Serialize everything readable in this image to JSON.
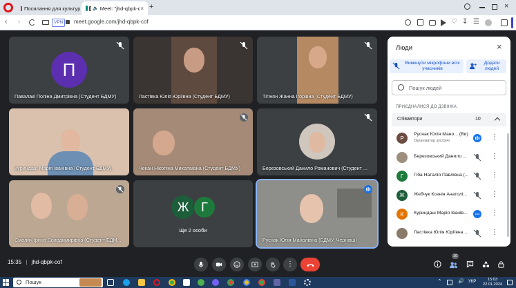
{
  "browser": {
    "tabs": [
      {
        "label": "Посилання для культур"
      },
      {
        "label": "Meet: \"jhd-qbpk-c"
      }
    ],
    "vpn_label": "VPN",
    "url": "meet.google.com/jhd-qbpk-cof"
  },
  "tiles": [
    {
      "name": "Павалакі Поліна Дмитрівна (Студент БДМУ)",
      "initial": "П",
      "avatar_color": "#5b2fb0"
    },
    {
      "name": "Ластівка Юлія Юріївна (Студент БДМУ)"
    },
    {
      "name": "Тігінян Жанна Ігорівна (Студент БДМУ)"
    },
    {
      "name": "Куриндаш Марія Іванівна (Студент БДМУ)"
    },
    {
      "name": "Чекан Ніколіна Миколаївна (Студент БДМУ)"
    },
    {
      "name": "Березовський Данило Романович (Студент ..."
    },
    {
      "name": "Смолич Ірина Володимирівна (Студент БДМ..."
    },
    {
      "name": "Ще 2 особи",
      "initials": [
        "Ж",
        "Г"
      ]
    },
    {
      "name": "Руснак Юлія Манолівна (БДМУ, Чернівці)"
    }
  ],
  "panel": {
    "title": "Люди",
    "mute_all": "Вимкнути мікрофони всіх учасників",
    "add_people": "Додати людей",
    "search_placeholder": "Пошук людей",
    "section_label": "ПРИЄДНАЛИСЯ ДО ДЗВІНКА",
    "group_label": "Співавтори",
    "group_count": "10",
    "participants": [
      {
        "initial": "Р",
        "color": "#6d4c41",
        "name": "Руснак Юлія Мано... (Ви)",
        "sub": "Організатор зустрічі",
        "state": "speaking"
      },
      {
        "initial": "",
        "color": "#9e8e7e",
        "name": "Березовський Данило ...",
        "state": "muted"
      },
      {
        "initial": "Г",
        "color": "#1e7a3c",
        "name": "Гіба Наталія Павлівна (...",
        "state": "muted"
      },
      {
        "initial": "Ж",
        "color": "#1d5e3a",
        "name": "Жебчук Ксенія Анатолі...",
        "state": "muted"
      },
      {
        "initial": "К",
        "color": "#e37400",
        "name": "Куриндаш Марія Іванів...",
        "state": "speaking-idle"
      },
      {
        "initial": "",
        "color": "#8a7a6a",
        "name": "Ластівка Юлія Юріївна ...",
        "state": "muted"
      }
    ]
  },
  "controls": {
    "time": "15:35",
    "separator": "|",
    "meeting_code": "jhd-qbpk-cof",
    "people_badge": "10"
  },
  "taskbar": {
    "search_label": "Пошук",
    "lang": "УКР",
    "clock_time": "15:03",
    "clock_date": "22.01.2024"
  }
}
